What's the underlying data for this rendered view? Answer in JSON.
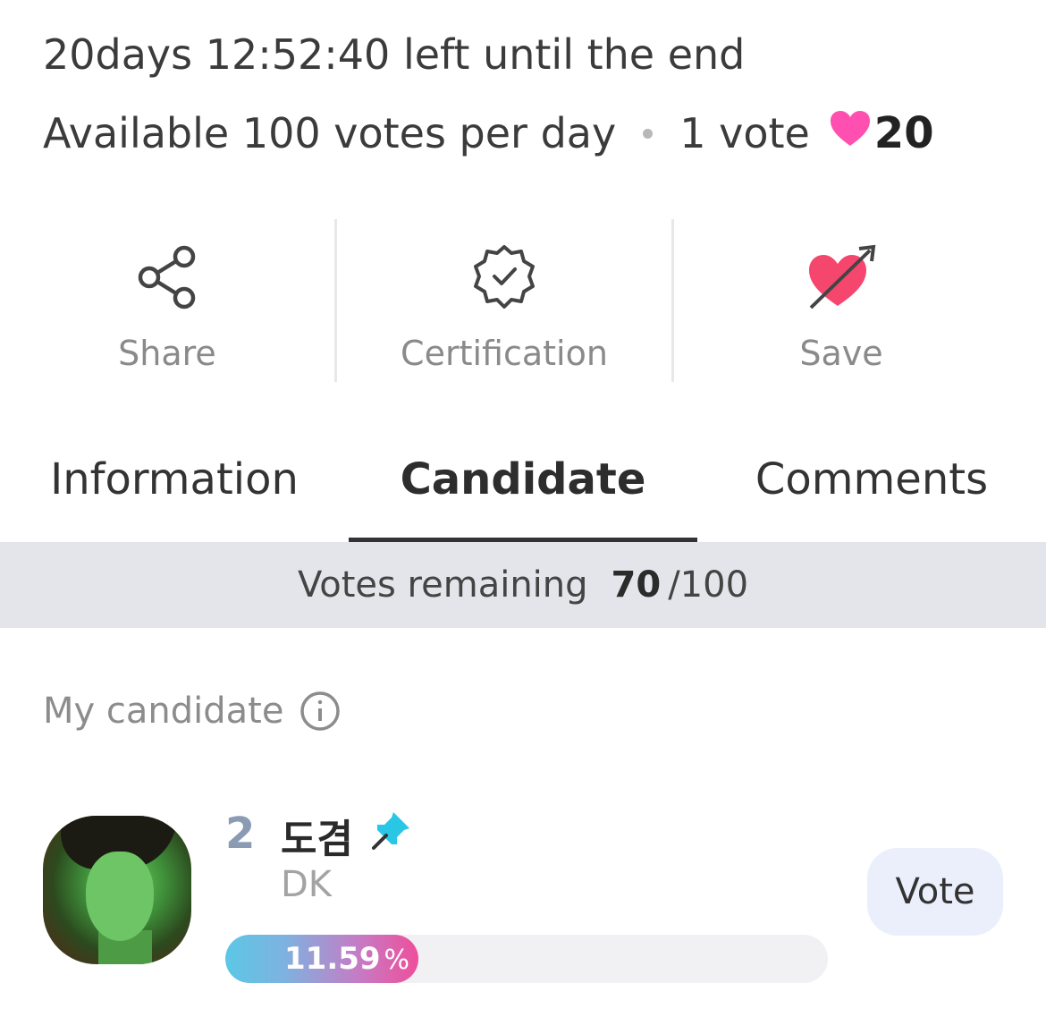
{
  "countdown": "20days 12:52:40 left until the end",
  "vote_info": {
    "available": "Available 100 votes per day",
    "per_vote": "1 vote",
    "heart_count": "20",
    "heart_color": "#ff4fb0"
  },
  "actions": [
    {
      "label": "Share",
      "icon": "share-icon"
    },
    {
      "label": "Certification",
      "icon": "certification-badge-icon"
    },
    {
      "label": "Save",
      "icon": "heart-arrow-icon"
    }
  ],
  "tabs": [
    {
      "label": "Information",
      "active": false
    },
    {
      "label": "Candidate",
      "active": true
    },
    {
      "label": "Comments",
      "active": false
    }
  ],
  "remaining": {
    "label": "Votes remaining",
    "value": "70",
    "total": "/100"
  },
  "my_candidate": {
    "label": "My candidate",
    "icon": "info-icon"
  },
  "candidate": {
    "rank": "2",
    "name_ko": "도겸",
    "name_en": "DK",
    "percent_value": "11.59",
    "percent_sign": "%",
    "fraction": 0.1159,
    "vote_label": "Vote",
    "pin_color": "#29c6e6"
  }
}
